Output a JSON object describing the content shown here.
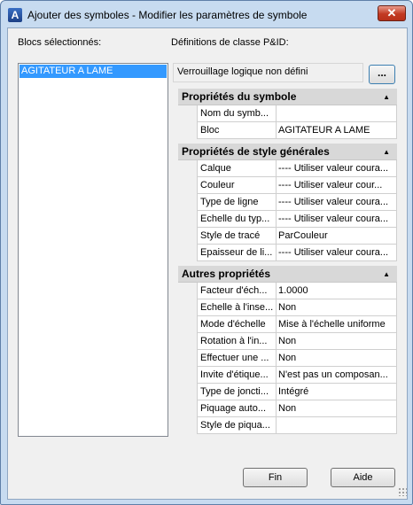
{
  "window": {
    "title": "Ajouter des symboles - Modifier les paramètres de symbole",
    "app_icon": "A",
    "close_glyph": "✕"
  },
  "left": {
    "label": "Blocs sélectionnés:",
    "items": [
      "AGITATEUR A LAME"
    ]
  },
  "right": {
    "label": "Définitions de classe P&ID:",
    "lock_text": "Verrouillage logique non défini",
    "ellipsis_label": "..."
  },
  "grid": {
    "categories": [
      {
        "title": "Propriétés du symbole",
        "arrow": "▲",
        "rows": [
          {
            "name": "Nom du symb...",
            "value": ""
          },
          {
            "name": "Bloc",
            "value": "AGITATEUR A LAME"
          }
        ]
      },
      {
        "title": "Propriétés de style générales",
        "arrow": "▲",
        "rows": [
          {
            "name": "Calque",
            "value": "---- Utiliser valeur coura..."
          },
          {
            "name": "Couleur",
            "value": "---- Utiliser valeur cour..."
          },
          {
            "name": "Type de ligne",
            "value": "---- Utiliser valeur coura..."
          },
          {
            "name": "Echelle du typ...",
            "value": "---- Utiliser valeur coura..."
          },
          {
            "name": "Style de tracé",
            "value": "ParCouleur"
          },
          {
            "name": "Epaisseur de li...",
            "value": "---- Utiliser valeur coura..."
          }
        ]
      },
      {
        "title": "Autres propriétés",
        "arrow": "▲",
        "rows": [
          {
            "name": "Facteur d'éch...",
            "value": "1.0000"
          },
          {
            "name": "Echelle à l'inse...",
            "value": "Non"
          },
          {
            "name": "Mode d'échelle",
            "value": "Mise à l'échelle uniforme"
          },
          {
            "name": "Rotation à l'in...",
            "value": "Non"
          },
          {
            "name": "Effectuer une ...",
            "value": "Non"
          },
          {
            "name": "Invite d'étique...",
            "value": "N'est pas un composan..."
          },
          {
            "name": "Type de joncti...",
            "value": "Intégré"
          },
          {
            "name": "Piquage auto...",
            "value": "Non"
          },
          {
            "name": "Style de piqua...",
            "value": ""
          }
        ]
      }
    ]
  },
  "buttons": {
    "fin": "Fin",
    "aide": "Aide"
  },
  "colors": {
    "selection": "#3399ff",
    "category_bg": "#d8d8d8",
    "close_red": "#c23a23"
  }
}
